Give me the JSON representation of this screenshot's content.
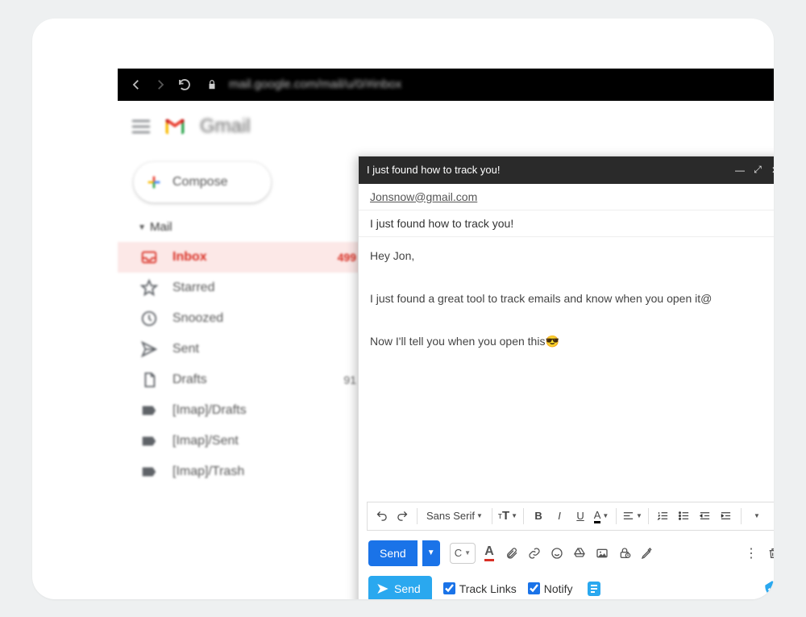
{
  "browser": {
    "url": "mail.google.com/mail/u/0/#inbox"
  },
  "header": {
    "product": "Gmail"
  },
  "compose_button": {
    "label": "Compose"
  },
  "sidebar": {
    "section_label": "Mail",
    "items": [
      {
        "label": "Inbox",
        "count": "499",
        "active": true,
        "icon": "inbox"
      },
      {
        "label": "Starred",
        "count": "",
        "active": false,
        "icon": "star"
      },
      {
        "label": "Snoozed",
        "count": "",
        "active": false,
        "icon": "clock"
      },
      {
        "label": "Sent",
        "count": "",
        "active": false,
        "icon": "send"
      },
      {
        "label": "Drafts",
        "count": "91",
        "active": false,
        "icon": "file"
      },
      {
        "label": "[Imap]/Drafts",
        "count": "",
        "active": false,
        "icon": "label"
      },
      {
        "label": "[Imap]/Sent",
        "count": "",
        "active": false,
        "icon": "label"
      },
      {
        "label": "[Imap]/Trash",
        "count": "",
        "active": false,
        "icon": "label"
      }
    ]
  },
  "compose": {
    "title": "I just found how to track you!",
    "to": "Jonsnow@gmail.com",
    "subject": "I just found how to track you!",
    "body_lines": [
      "Hey Jon,",
      "I just found a great tool to track emails and know when you open it@",
      "Now I'll tell you when you open this😎"
    ],
    "font": "Sans Serif",
    "send_label": "Send",
    "schedule_glyph": "C"
  },
  "tracking": {
    "send_label": "Send",
    "track_links_label": "Track Links",
    "notify_label": "Notify",
    "track_links_checked": true,
    "notify_checked": true
  }
}
